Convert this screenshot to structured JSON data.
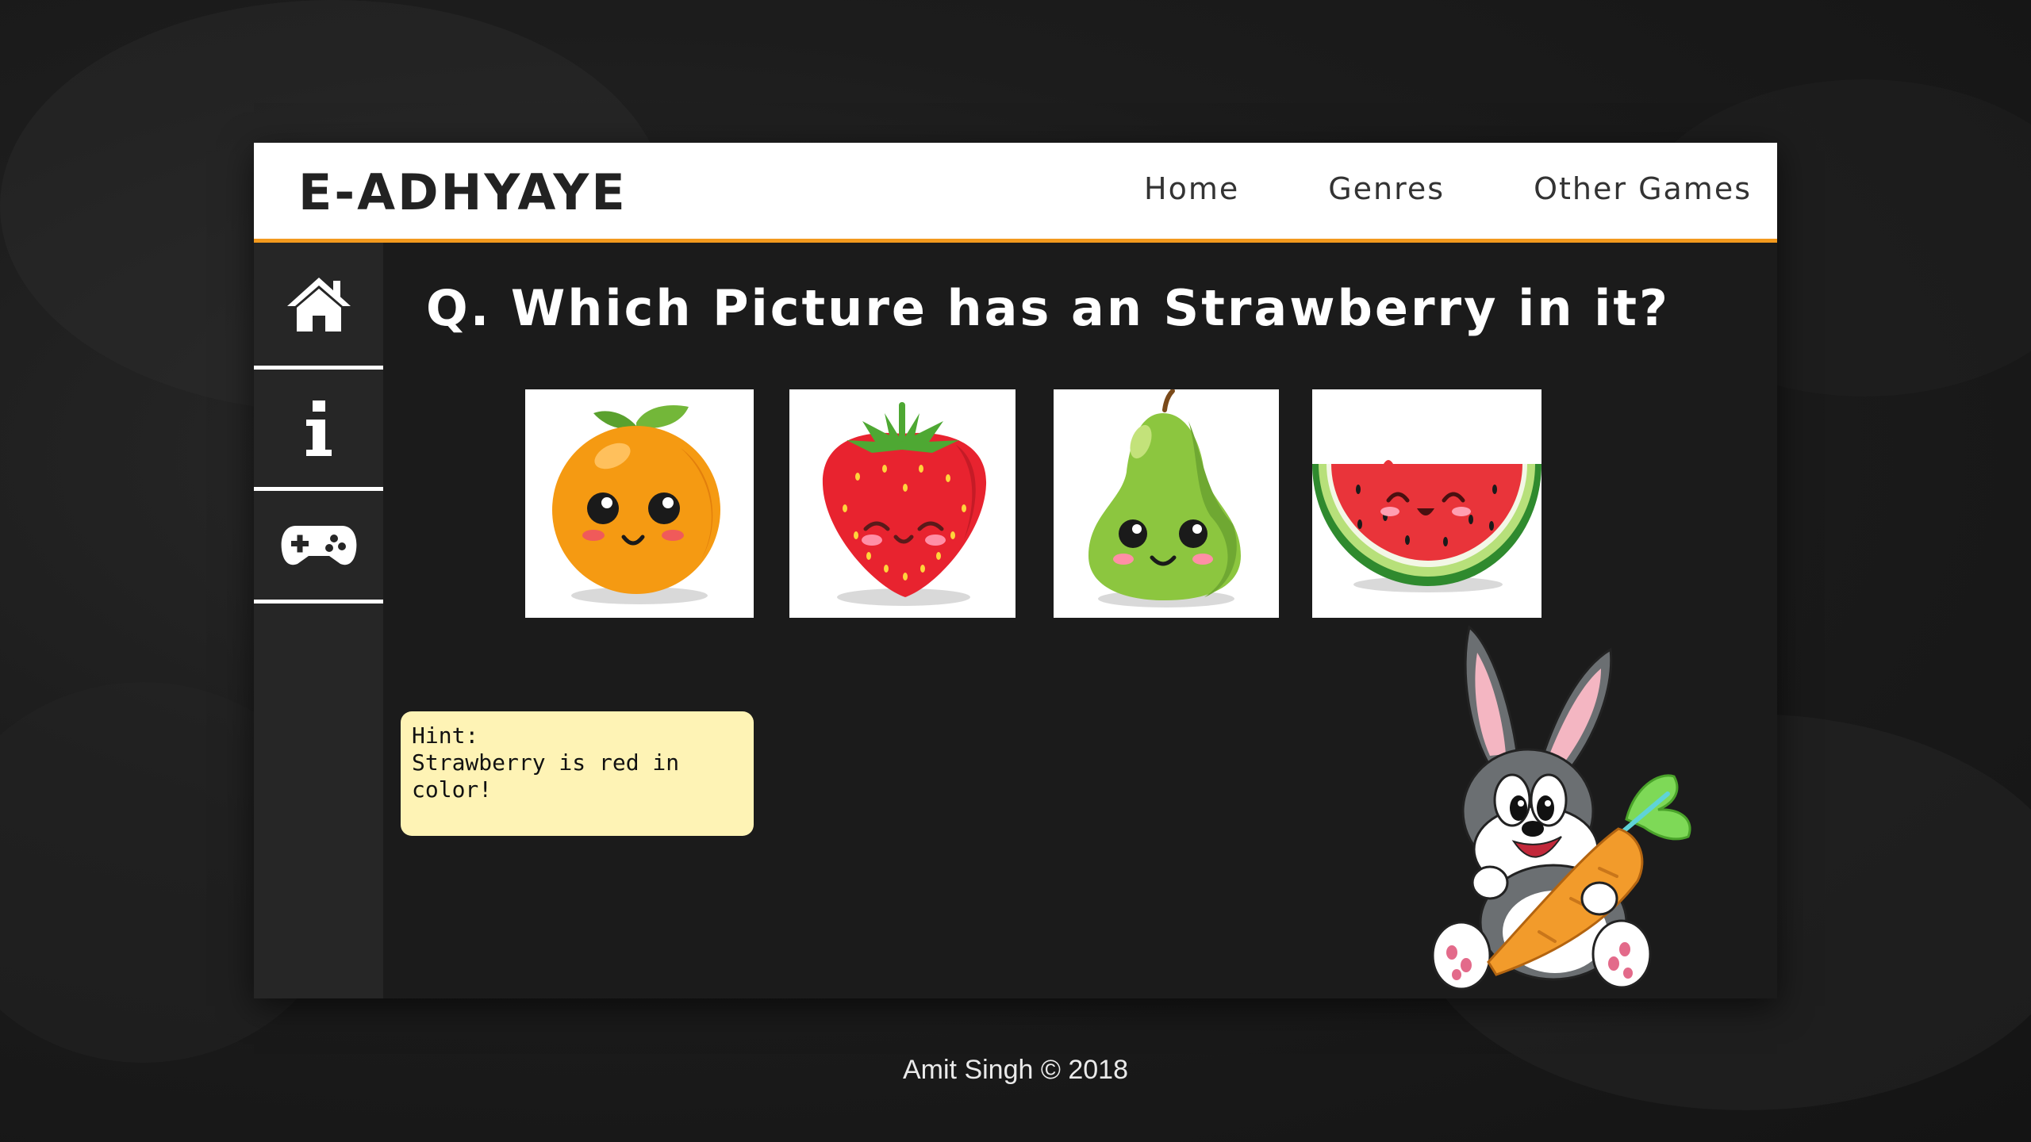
{
  "header": {
    "logo": "E-ADHYAYE",
    "nav": [
      "Home",
      "Genres",
      "Other Games"
    ]
  },
  "sidebar": {
    "icons": [
      "home-icon",
      "info-icon",
      "gamepad-icon"
    ]
  },
  "quiz": {
    "question": "Q. Which Picture has an Strawberry in it?",
    "choices": [
      {
        "fruit": "orange",
        "icon": "orange-icon"
      },
      {
        "fruit": "strawberry",
        "icon": "strawberry-icon"
      },
      {
        "fruit": "pear",
        "icon": "pear-icon"
      },
      {
        "fruit": "watermelon",
        "icon": "watermelon-icon"
      }
    ],
    "hint_title": "Hint:",
    "hint_text": "Strawberry is red in color!"
  },
  "footer": "Amit Singh © 2018",
  "colors": {
    "accent": "#f39a1e",
    "app_bg": "#1b1b1b",
    "sidebar_bg": "#262626",
    "hint_bg": "#fef3b5"
  }
}
